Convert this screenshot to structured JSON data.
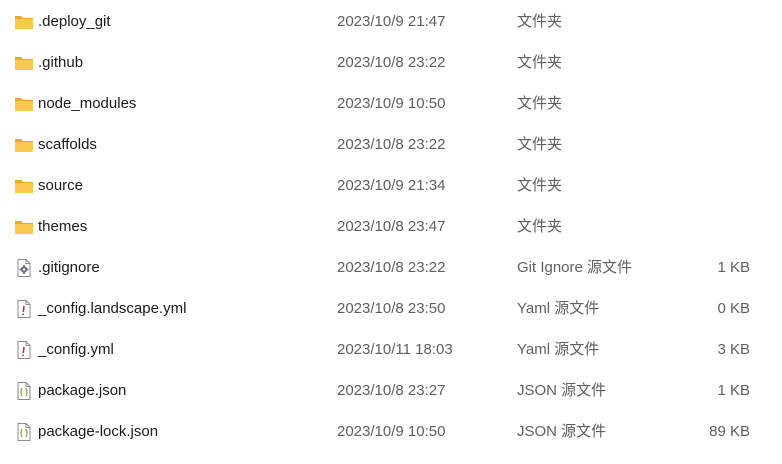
{
  "files": [
    {
      "name": ".deploy_git",
      "date": "2023/10/9 21:47",
      "type": "文件夹",
      "size": "",
      "icon": "folder-icon"
    },
    {
      "name": ".github",
      "date": "2023/10/8 23:22",
      "type": "文件夹",
      "size": "",
      "icon": "folder-icon"
    },
    {
      "name": "node_modules",
      "date": "2023/10/9 10:50",
      "type": "文件夹",
      "size": "",
      "icon": "folder-icon"
    },
    {
      "name": "scaffolds",
      "date": "2023/10/8 23:22",
      "type": "文件夹",
      "size": "",
      "icon": "folder-icon"
    },
    {
      "name": "source",
      "date": "2023/10/9 21:34",
      "type": "文件夹",
      "size": "",
      "icon": "folder-icon"
    },
    {
      "name": "themes",
      "date": "2023/10/8 23:47",
      "type": "文件夹",
      "size": "",
      "icon": "folder-icon"
    },
    {
      "name": ".gitignore",
      "date": "2023/10/8 23:22",
      "type": "Git Ignore 源文件",
      "size": "1 KB",
      "icon": "settings-file-icon"
    },
    {
      "name": "_config.landscape.yml",
      "date": "2023/10/8 23:50",
      "type": "Yaml 源文件",
      "size": "0 KB",
      "icon": "yaml-file-icon"
    },
    {
      "name": "_config.yml",
      "date": "2023/10/11 18:03",
      "type": "Yaml 源文件",
      "size": "3 KB",
      "icon": "yaml-file-icon"
    },
    {
      "name": "package.json",
      "date": "2023/10/8 23:27",
      "type": "JSON 源文件",
      "size": "1 KB",
      "icon": "json-file-icon"
    },
    {
      "name": "package-lock.json",
      "date": "2023/10/9 10:50",
      "type": "JSON 源文件",
      "size": "89 KB",
      "icon": "json-file-icon"
    }
  ],
  "colors": {
    "folder": "#f8c94a",
    "folder_dark": "#e8a92a",
    "text_primary": "#1b1b1b",
    "text_secondary": "#5f5f5f"
  }
}
